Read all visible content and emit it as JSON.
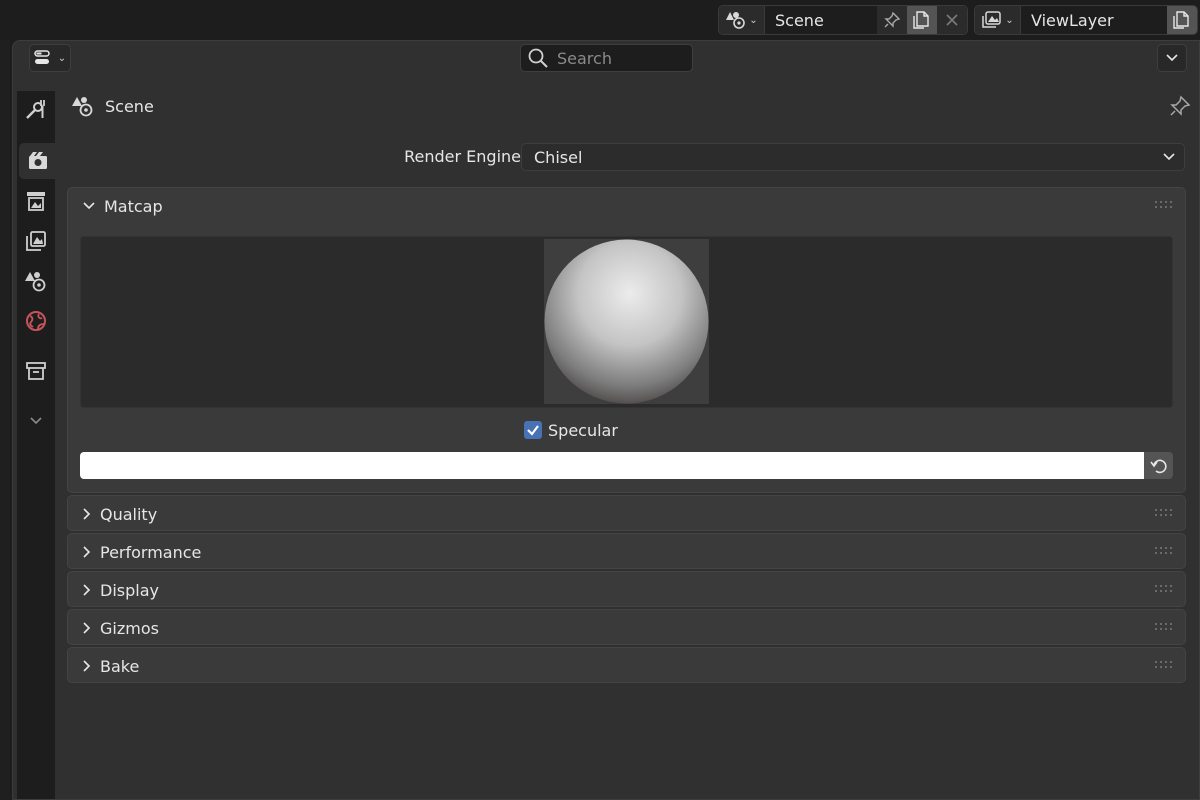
{
  "header": {
    "scene_name": "Scene",
    "view_layer_name": "ViewLayer"
  },
  "panel": {
    "search_placeholder": "Search",
    "context_label": "Scene"
  },
  "render": {
    "engine_label": "Render Engine",
    "engine_value": "Chisel"
  },
  "matcap": {
    "title": "Matcap",
    "specular_label": "Specular",
    "specular_checked": true,
    "color": "#ffffff"
  },
  "sections": [
    {
      "title": "Quality"
    },
    {
      "title": "Performance"
    },
    {
      "title": "Display"
    },
    {
      "title": "Gizmos"
    },
    {
      "title": "Bake"
    }
  ],
  "tabs": [
    {
      "icon": "tool-icon"
    },
    {
      "icon": "render-icon",
      "active": true
    },
    {
      "icon": "output-icon"
    },
    {
      "icon": "view-layer-icon"
    },
    {
      "icon": "scene-icon"
    },
    {
      "icon": "world-icon"
    },
    {
      "icon": "collection-icon"
    },
    {
      "icon": "chevron-down-icon"
    }
  ],
  "colors": {
    "accent": "#4772b3",
    "world_icon": "#c7545a"
  }
}
